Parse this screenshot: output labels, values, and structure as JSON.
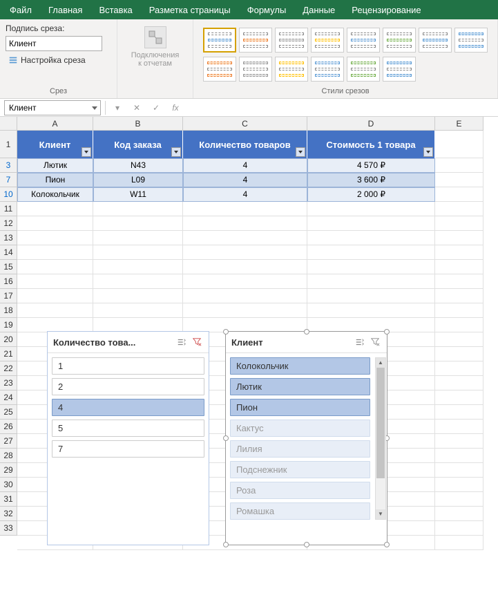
{
  "menu": [
    "Файл",
    "Главная",
    "Вставка",
    "Разметка страницы",
    "Формулы",
    "Данные",
    "Рецензирование"
  ],
  "ribbon": {
    "caption_label": "Подпись среза:",
    "caption_value": "Клиент",
    "settings_btn": "Настройка среза",
    "group1_label": "Срез",
    "connections_btn": "Подключения к отчетам",
    "group3_label": "Стили срезов"
  },
  "namebox": "Клиент",
  "columns": [
    "A",
    "B",
    "C",
    "D",
    "E"
  ],
  "row_numbers": [
    "1",
    "3",
    "7",
    "10",
    "11",
    "12",
    "13",
    "14",
    "15",
    "16",
    "17",
    "18",
    "19",
    "20",
    "21",
    "22",
    "23",
    "24",
    "25",
    "26",
    "27",
    "28",
    "29",
    "30",
    "31",
    "32",
    "33"
  ],
  "table": {
    "headers": [
      "Клиент",
      "Код заказа",
      "Количество товаров",
      "Стоимость 1 товара"
    ],
    "rows": [
      [
        "Лютик",
        "N43",
        "4",
        "4 570 ₽"
      ],
      [
        "Пион",
        "L09",
        "4",
        "3 600 ₽"
      ],
      [
        "Колокольчик",
        "W11",
        "4",
        "2 000 ₽"
      ]
    ]
  },
  "slicer1": {
    "title": "Количество това...",
    "items": [
      {
        "label": "1",
        "selected": false
      },
      {
        "label": "2",
        "selected": false
      },
      {
        "label": "4",
        "selected": true
      },
      {
        "label": "5",
        "selected": false
      },
      {
        "label": "7",
        "selected": false
      }
    ]
  },
  "slicer2": {
    "title": "Клиент",
    "items": [
      {
        "label": "Колокольчик",
        "state": "selected"
      },
      {
        "label": "Лютик",
        "state": "selected"
      },
      {
        "label": "Пион",
        "state": "selected"
      },
      {
        "label": "Кактус",
        "state": "dimmed"
      },
      {
        "label": "Лилия",
        "state": "dimmed"
      },
      {
        "label": "Подснежник",
        "state": "dimmed"
      },
      {
        "label": "Роза",
        "state": "dimmed"
      },
      {
        "label": "Ромашка",
        "state": "dimmed"
      }
    ]
  }
}
